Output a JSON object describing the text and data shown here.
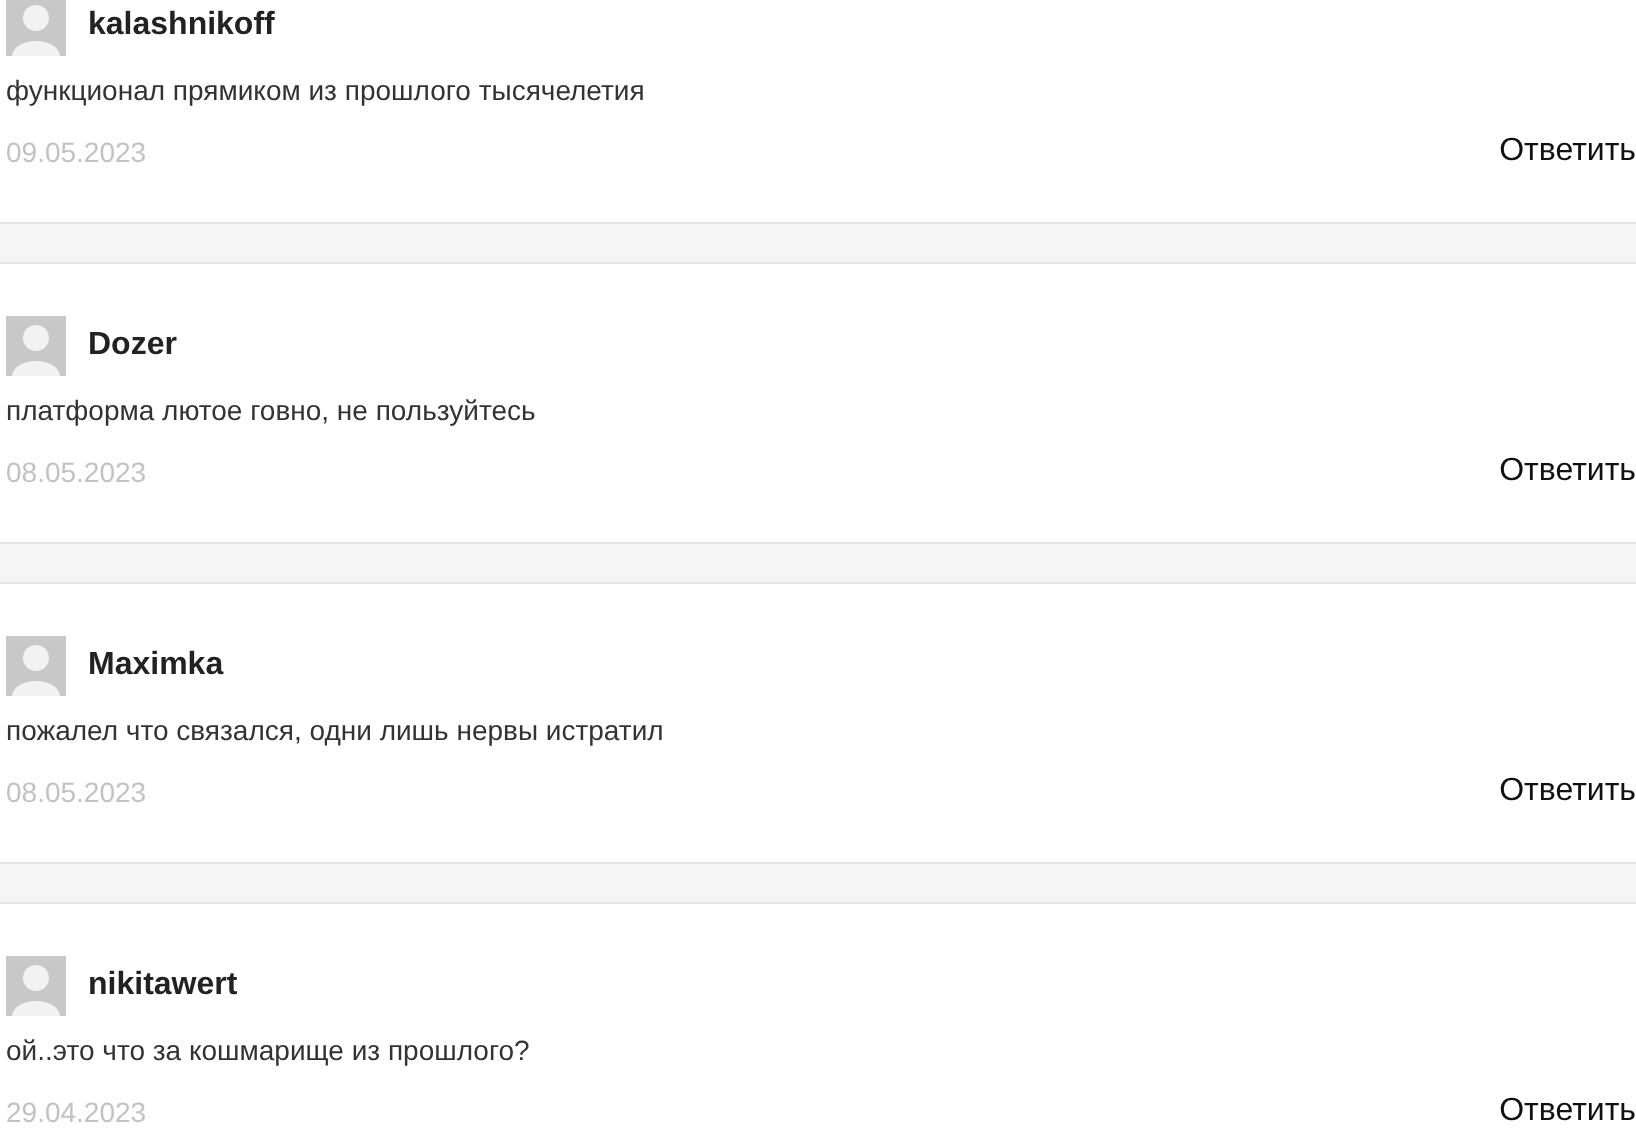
{
  "comments": [
    {
      "author": "kalashnikoff",
      "text": "функционал прямиком из прошлого тысячелетия",
      "date": "09.05.2023",
      "reply": "Ответить"
    },
    {
      "author": "Dozer",
      "text": "платформа лютое говно, не пользуйтесь",
      "date": "08.05.2023",
      "reply": "Ответить"
    },
    {
      "author": "Maximka",
      "text": "пожалел что связался, одни лишь нервы истратил",
      "date": "08.05.2023",
      "reply": "Ответить"
    },
    {
      "author": "nikitawert",
      "text": "ой..это что за кошмарище из прошлого?",
      "date": "29.04.2023",
      "reply": "Ответить"
    }
  ]
}
